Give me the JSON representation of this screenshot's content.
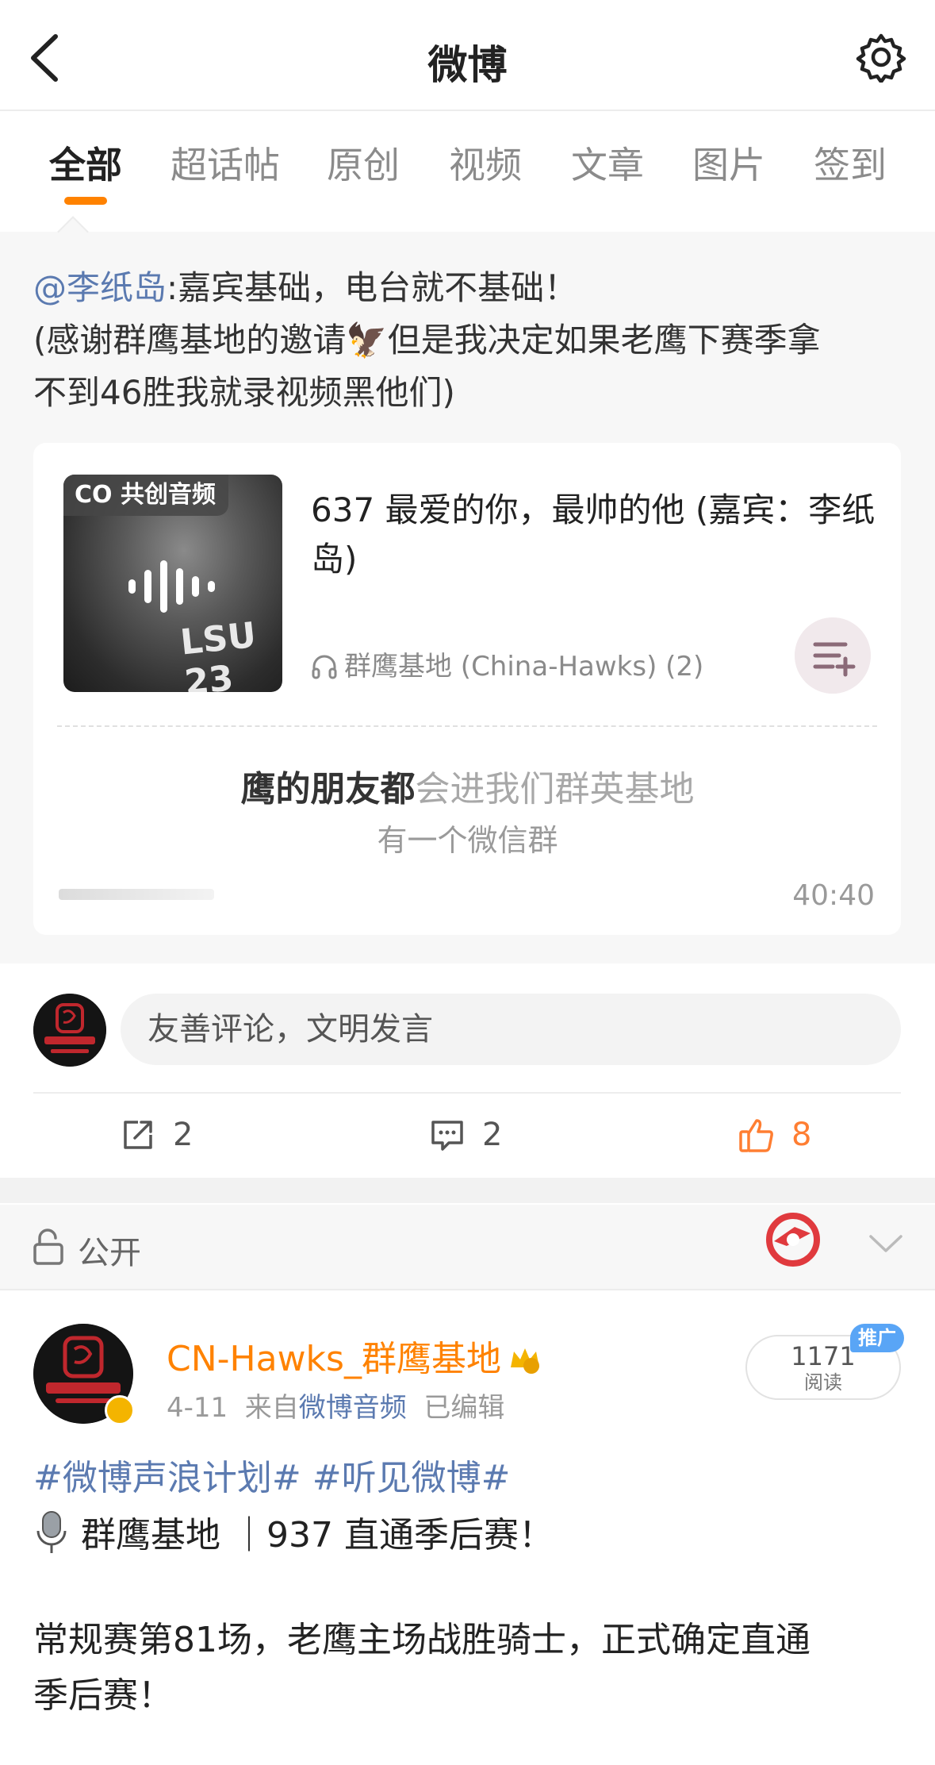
{
  "header": {
    "title": "微博"
  },
  "tabs": [
    "全部",
    "超话帖",
    "原创",
    "视频",
    "文章",
    "图片",
    "签到"
  ],
  "repost": {
    "mention": "@李纸岛",
    "text_after_mention": ":嘉宾基础，电台就不基础！",
    "line2": "(感谢群鹰基地的邀请🦅但是我决定如果老鹰下赛季拿",
    "line3": "不到46胜我就录视频黑他们)"
  },
  "audio_card": {
    "badge": "CO 共创音频",
    "jersey_text": "LSU 23",
    "title": "637 最爱的你，最帅的他 (嘉宾：李纸岛)",
    "source": "群鹰基地 (China-Hawks) (2)",
    "lyric_strong": "鹰的朋友都",
    "lyric_faint": "会进我们群英基地",
    "lyric_line2": "有一个微信群",
    "duration": "40:40"
  },
  "comment": {
    "placeholder": "友善评论，文明发言"
  },
  "actions": {
    "repost_count": "2",
    "comment_count": "2",
    "like_count": "8"
  },
  "visibility": {
    "label": "公开"
  },
  "post": {
    "author": "CN-Hawks_群鹰基地",
    "date": "4-11",
    "from_prefix": "来自",
    "source": "微博音频",
    "edited": "已编辑",
    "reads": "1171",
    "reads_label": "阅读",
    "promo": "推广",
    "tags": "#微博声浪计划#  #听见微博#",
    "line1": "群鹰基地 ｜937 直通季后赛！",
    "body_line1": "常规赛第81场，老鹰主场战胜骑士，正式确定直通",
    "body_line2": "季后赛！"
  },
  "colors": {
    "accent": "#ff8200",
    "link": "#5b7ab0",
    "like": "#ff7e32",
    "promo": "#59a5f6"
  }
}
